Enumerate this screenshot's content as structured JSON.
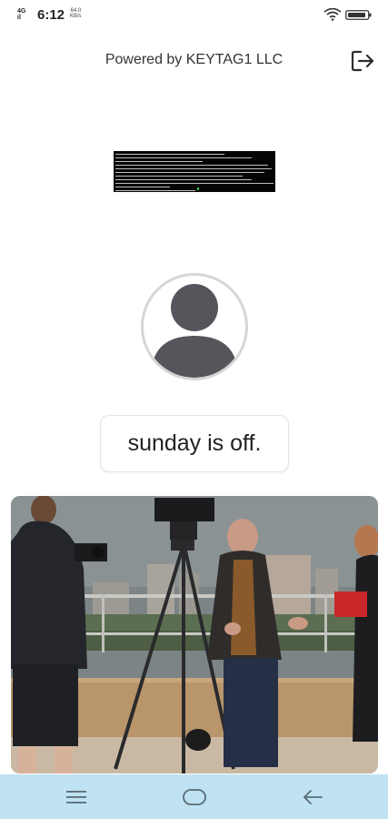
{
  "status_bar": {
    "network": "4G",
    "signal": "il",
    "time": "6:12",
    "speed_value": "64.0",
    "speed_unit": "KB/s"
  },
  "header": {
    "powered_by": "Powered by KEYTAG1 LLC",
    "logout_icon": "logout-icon"
  },
  "profile": {
    "avatar_icon": "person-icon",
    "status_message": "sunday is off."
  },
  "colors": {
    "nav_bar": "#bfe3f2",
    "avatar_fill": "#54565c",
    "terminal_bg": "#050505"
  },
  "nav_bar": {
    "icons": [
      "menu-icon",
      "home-icon",
      "back-icon"
    ]
  }
}
